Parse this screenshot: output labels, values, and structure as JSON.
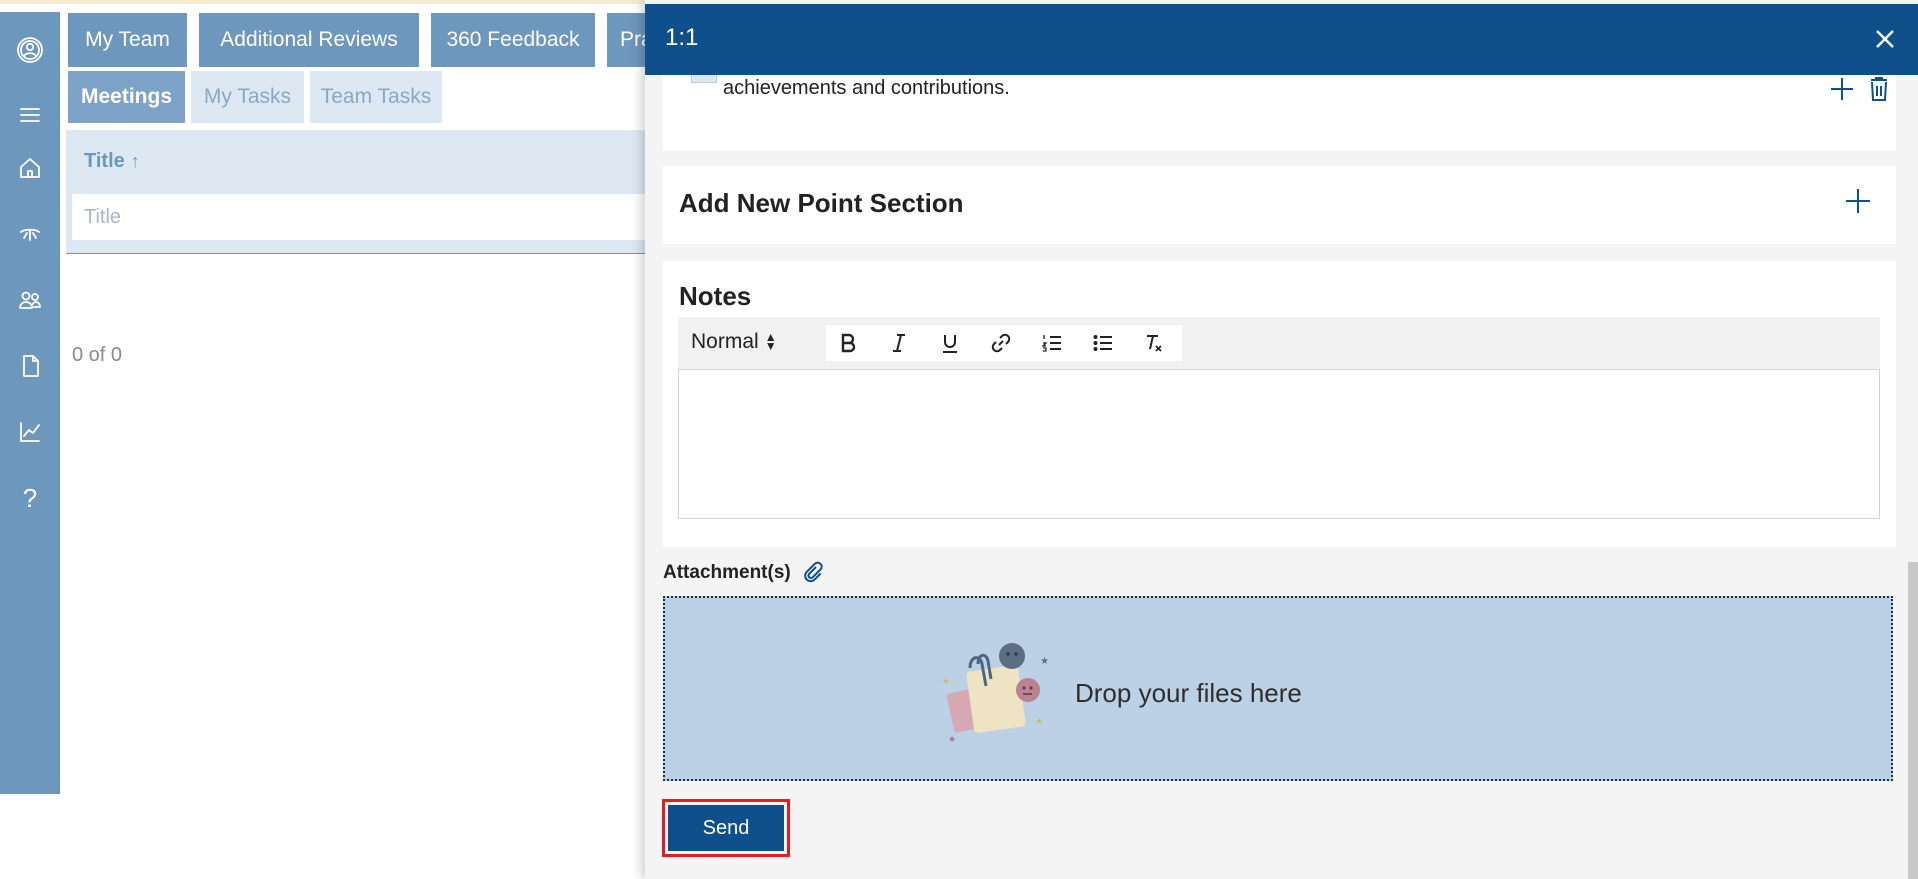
{
  "nav": {
    "tabs": [
      "My Team",
      "Additional Reviews",
      "360 Feedback",
      "Pra"
    ],
    "subtabs": [
      "Meetings",
      "My Tasks",
      "Team Tasks"
    ]
  },
  "rail": {
    "icons": [
      "avatar-icon",
      "menu-icon",
      "home-icon",
      "scale-icon",
      "team-icon",
      "document-icon",
      "chart-icon",
      "help-icon"
    ],
    "help_glyph": "?"
  },
  "grid": {
    "column_title": "Title",
    "sort_indicator": "↑",
    "filter_placeholder": "Title",
    "pager_text": "0 of 0"
  },
  "panel": {
    "title": "1:1",
    "point_text": "achievements and contributions.",
    "add_section_label": "Add New Point Section",
    "notes_label": "Notes",
    "format_select": "Normal",
    "attachments_label": "Attachment(s)",
    "drop_text": "Drop your files here",
    "send_label": "Send"
  },
  "colors": {
    "header": "#0e4f8c",
    "rail": "#6e97bd",
    "dropzone": "#bcd1e6",
    "highlight": "#e02020"
  }
}
